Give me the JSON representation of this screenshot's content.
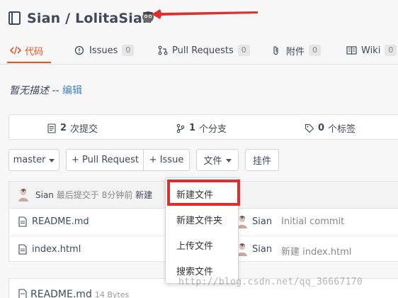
{
  "repo": {
    "title": "Sian / LolitaSian"
  },
  "tabs": [
    {
      "label": "代码",
      "count": ""
    },
    {
      "label": "Issues",
      "count": "0"
    },
    {
      "label": "Pull Requests",
      "count": "0"
    },
    {
      "label": "附件",
      "count": "0"
    },
    {
      "label": "Wiki",
      "count": "0"
    }
  ],
  "description": {
    "text": "暂无描述",
    "separator": " -- ",
    "edit_label": "编辑"
  },
  "stats": {
    "commits": {
      "count": "2",
      "label": "次提交"
    },
    "branches": {
      "count": "1",
      "label": "个分支"
    },
    "tags": {
      "count": "0",
      "label": "个标签"
    }
  },
  "toolbar": {
    "branch": "master",
    "pull_request": "+ Pull Request",
    "issue": "+ Issue",
    "file_menu": "文件",
    "pendant": "挂件"
  },
  "last_commit": {
    "author": "Sian",
    "text": "最后提交于",
    "time": "8分钟前",
    "message": "新建"
  },
  "files": [
    {
      "name": "README.md",
      "author": "Sian",
      "message": "Initial commit"
    },
    {
      "name": "index.html",
      "author": "Sian",
      "message": "新建 index.html"
    }
  ],
  "file_dropdown": {
    "items": [
      "新建文件",
      "新建文件夹",
      "上传文件",
      "搜索文件"
    ]
  },
  "readme": {
    "name": "README.md",
    "size": "14 Bytes"
  },
  "watermark": "http://blog.csdn.net/qq_36667170",
  "colors": {
    "accent": "#e9531d",
    "annotation": "#e02e2e",
    "link": "#4183c4"
  }
}
